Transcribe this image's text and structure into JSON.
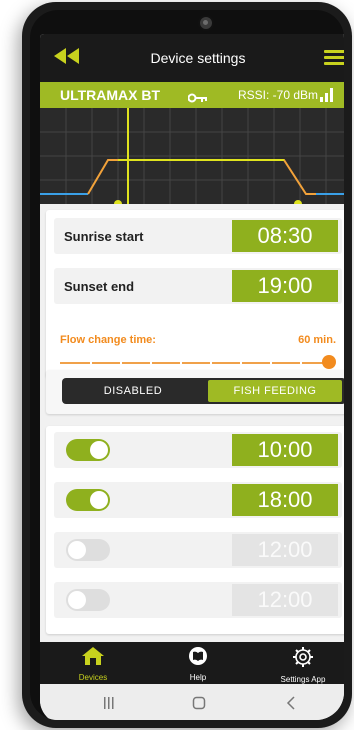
{
  "header": {
    "title": "Device settings"
  },
  "device": {
    "name": "ULTRAMAX BT",
    "rssi": "RSSI: -70 dBm"
  },
  "sun": {
    "sunrise_label": "Sunrise start",
    "sunrise_time": "08:30",
    "sunset_label": "Sunset end",
    "sunset_time": "19:00"
  },
  "flow": {
    "label": "Flow change time:",
    "value": "60 min.",
    "slider_fraction": 1.0
  },
  "mode": {
    "options": [
      "DISABLED",
      "FISH FEEDING"
    ],
    "selected": "FISH FEEDING"
  },
  "feeding": [
    {
      "enabled": true,
      "time": "10:00"
    },
    {
      "enabled": true,
      "time": "18:00"
    },
    {
      "enabled": false,
      "time": "12:00"
    },
    {
      "enabled": false,
      "time": "12:00"
    }
  ],
  "nav": {
    "devices": "Devices",
    "help": "Help",
    "settings": "Settings App"
  },
  "colors": {
    "accent_green": "#9fba24",
    "accent_yellow": "#c8d21e",
    "orange": "#f28b1e",
    "dark": "#1a1a1a"
  },
  "icons": {
    "back": "double-chevron-left-icon",
    "menu": "hamburger-menu-icon",
    "key": "key-icon",
    "signal": "signal-bars-icon",
    "devices": "house-icon",
    "help": "book-icon",
    "settings": "gear-icon"
  }
}
